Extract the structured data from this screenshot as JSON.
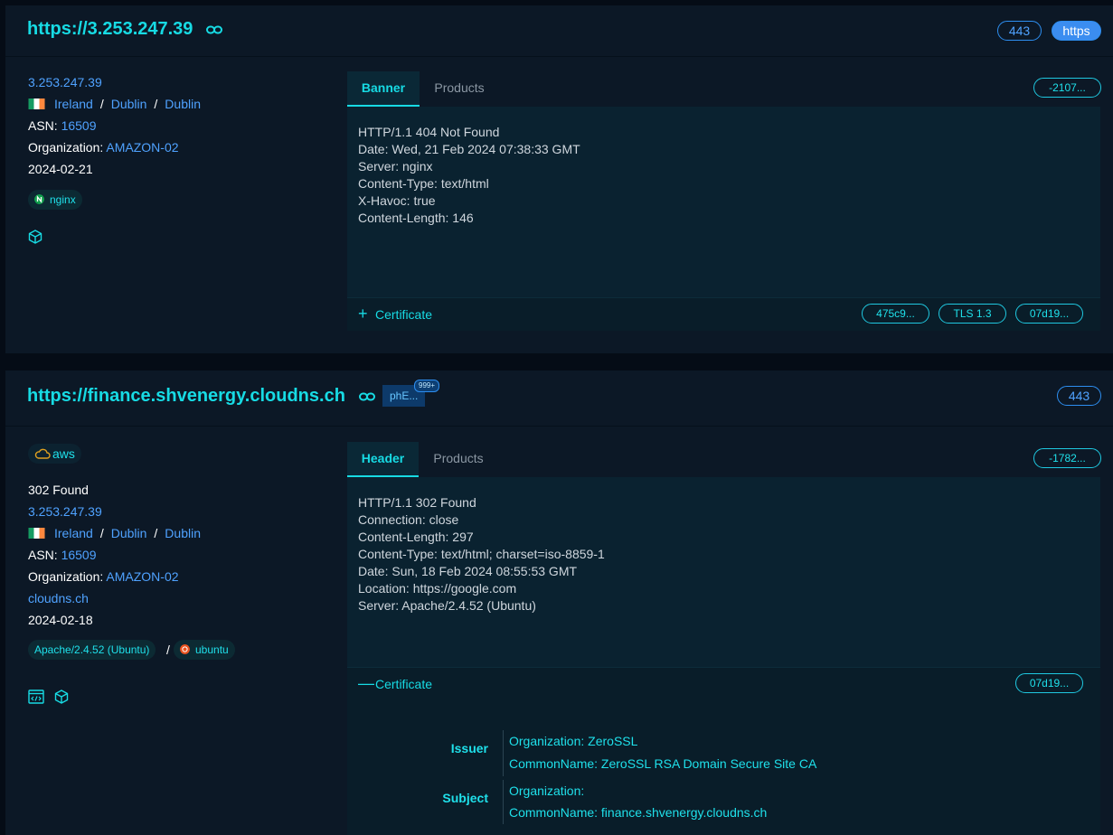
{
  "results": [
    {
      "url": "https://3.253.247.39",
      "port": "443",
      "protocol": "https",
      "ip": "3.253.247.39",
      "location": {
        "country": "Ireland",
        "region": "Dublin",
        "city": "Dublin",
        "flag_colors": [
          "#169b62",
          "#ffffff",
          "#ff883e"
        ]
      },
      "asn_label": "ASN:",
      "asn": "16509",
      "org_label": "Organization:",
      "org": "AMAZON-02",
      "date": "2024-02-21",
      "technology": {
        "name": "nginx",
        "icon": "nginx-icon"
      },
      "tabs": [
        "Banner",
        "Products"
      ],
      "hash_pill": "-2107...",
      "content": "HTTP/1.1 404 Not Found\nDate: Wed, 21 Feb 2024 07:38:33 GMT\nServer: nginx\nContent-Type: text/html\nX-Havoc: true\nContent-Length: 146",
      "certificate": {
        "label": "Certificate",
        "toggle": "+",
        "pills": [
          "475c9...",
          "TLS 1.3",
          "07d19..."
        ]
      }
    },
    {
      "url": "https://finance.shvenergy.cloudns.ch",
      "tag": "phE...",
      "tag_badge": "999+",
      "port": "443",
      "cloud": "aws",
      "status": "302 Found",
      "ip": "3.253.247.39",
      "location": {
        "country": "Ireland",
        "region": "Dublin",
        "city": "Dublin",
        "flag_colors": [
          "#169b62",
          "#ffffff",
          "#ff883e"
        ]
      },
      "asn_label": "ASN:",
      "asn": "16509",
      "org_label": "Organization:",
      "org": "AMAZON-02",
      "domain": "cloudns.ch",
      "date": "2024-02-18",
      "technologies": {
        "server": "Apache/2.4.52 (Ubuntu)",
        "separator": "/",
        "os": "ubuntu",
        "os_icon": "ubuntu-icon"
      },
      "tabs": [
        "Header",
        "Products"
      ],
      "hash_pill": "-1782...",
      "content": "HTTP/1.1 302 Found\nConnection: close\nContent-Length: 297\nContent-Type: text/html; charset=iso-8859-1\nDate: Sun, 18 Feb 2024 08:55:53 GMT\nLocation: https://google.com\nServer: Apache/2.4.52 (Ubuntu)",
      "certificate": {
        "label": "Certificate",
        "toggle": "—",
        "pills": [
          "07d19..."
        ],
        "issuer_label": "Issuer",
        "issuer_org": "Organization: ZeroSSL",
        "issuer_cn": "CommonName: ZeroSSL RSA Domain Secure Site CA",
        "subject_label": "Subject",
        "subject_org": "Organization:",
        "subject_cn": "CommonName: finance.shvenergy.cloudns.ch"
      }
    }
  ],
  "colors": {
    "accent": "#17dbe4",
    "link": "#4fa2ff",
    "card_bg": "#0c1826",
    "page_bg": "#050c16"
  }
}
